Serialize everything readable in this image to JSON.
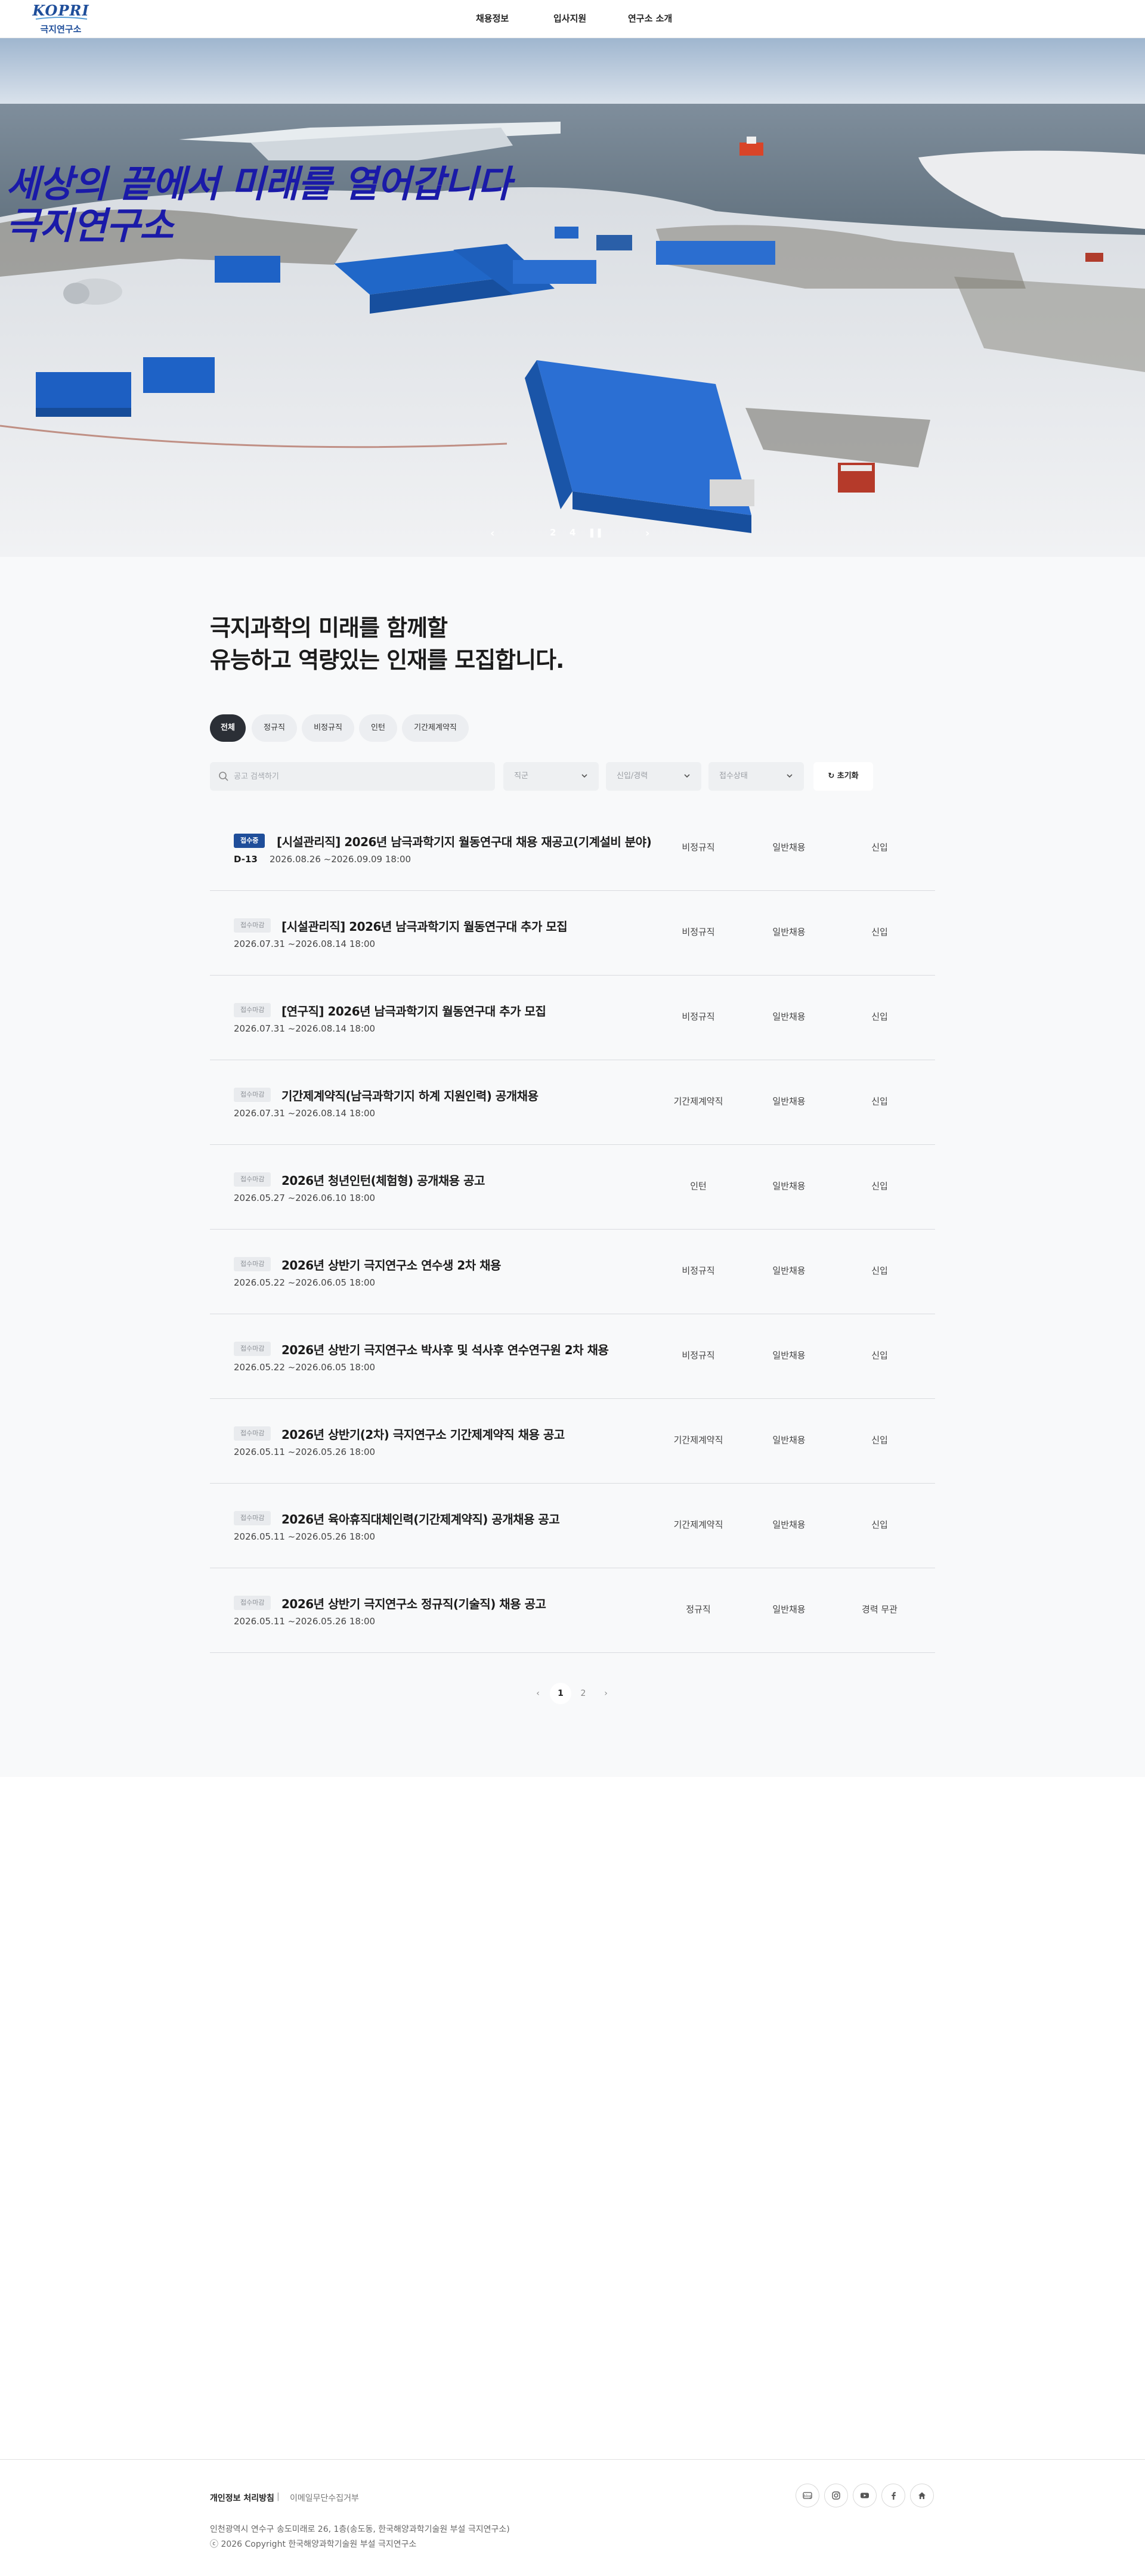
{
  "brand": {
    "logo_en": "KOPRI",
    "logo_ko": "극지연구소",
    "color": "#1f4e9a"
  },
  "nav": [
    {
      "label": "채용정보"
    },
    {
      "label": "입사지원"
    },
    {
      "label": "연구소 소개"
    }
  ],
  "hero": {
    "line1": "세상의 끝에서 미래를 열어갑니다",
    "line2": "극지연구소",
    "slide_current": "2",
    "slide_total": "4",
    "prev_icon": "chevron-left-icon",
    "pause_icon": "pause-icon",
    "next_icon": "chevron-right-icon"
  },
  "headline": {
    "line1": "극지과학의 미래를 함께할",
    "line2": "유능하고 역량있는 인재를 모집합니다."
  },
  "tabs": [
    {
      "label": "전체",
      "active": true
    },
    {
      "label": "정규직"
    },
    {
      "label": "비정규직"
    },
    {
      "label": "인턴"
    },
    {
      "label": "기간제계약직"
    }
  ],
  "filters": {
    "search_placeholder": "공고 검색하기",
    "search_value": "",
    "selects": [
      {
        "label": "직군"
      },
      {
        "label": "신입/경력"
      },
      {
        "label": "접수상태"
      }
    ],
    "reset_label": "초기화"
  },
  "postings": [
    {
      "status": "접수중",
      "open": true,
      "dday": "D-13",
      "title": "[시설관리직] 2026년 남극과학기지 월동연구대 채용 재공고(기계설비 분야)",
      "period": "2026.08.26 ~2026.09.09 18:00",
      "type": "비정규직",
      "hire": "일반채용",
      "career": "신입"
    },
    {
      "status": "접수마감",
      "title": "[시설관리직] 2026년 남극과학기지 월동연구대 추가 모집",
      "period": "2026.07.31 ~2026.08.14 18:00",
      "type": "비정규직",
      "hire": "일반채용",
      "career": "신입"
    },
    {
      "status": "접수마감",
      "title": "[연구직] 2026년 남극과학기지 월동연구대 추가 모집",
      "period": "2026.07.31 ~2026.08.14 18:00",
      "type": "비정규직",
      "hire": "일반채용",
      "career": "신입"
    },
    {
      "status": "접수마감",
      "title": "기간제계약직(남극과학기지 하계 지원인력) 공개채용",
      "period": "2026.07.31 ~2026.08.14 18:00",
      "type": "기간제계약직",
      "hire": "일반채용",
      "career": "신입"
    },
    {
      "status": "접수마감",
      "title": "2026년 청년인턴(체험형) 공개채용 공고",
      "period": "2026.05.27 ~2026.06.10 18:00",
      "type": "인턴",
      "hire": "일반채용",
      "career": "신입"
    },
    {
      "status": "접수마감",
      "title": "2026년 상반기 극지연구소 연수생 2차 채용",
      "period": "2026.05.22 ~2026.06.05 18:00",
      "type": "비정규직",
      "hire": "일반채용",
      "career": "신입"
    },
    {
      "status": "접수마감",
      "title": "2026년 상반기 극지연구소 박사후 및 석사후 연수연구원 2차 채용",
      "period": "2026.05.22 ~2026.06.05 18:00",
      "type": "비정규직",
      "hire": "일반채용",
      "career": "신입"
    },
    {
      "status": "접수마감",
      "title": "2026년 상반기(2차) 극지연구소 기간제계약직 채용 공고",
      "period": "2026.05.11 ~2026.05.26 18:00",
      "type": "기간제계약직",
      "hire": "일반채용",
      "career": "신입"
    },
    {
      "status": "접수마감",
      "title": "2026년 육아휴직대체인력(기간제계약직) 공개채용 공고",
      "period": "2026.05.11 ~2026.05.26 18:00",
      "type": "기간제계약직",
      "hire": "일반채용",
      "career": "신입"
    },
    {
      "status": "접수마감",
      "title": "2026년 상반기 극지연구소 정규직(기술직) 채용 공고",
      "period": "2026.05.11 ~2026.05.26 18:00",
      "type": "정규직",
      "hire": "일반채용",
      "career": "경력 무관"
    }
  ],
  "pagination": {
    "pages": [
      "1",
      "2"
    ],
    "current": "1",
    "prev": "‹",
    "next": "›"
  },
  "footer": {
    "privacy": "개인정보 처리방침",
    "email_refusal": "이메일무단수집거부",
    "separator": "|",
    "address": "인천광역시 연수구 송도미래로 26, 1층(송도동, 한국해양과학기술원 부설 극지연구소)",
    "copyright": "ⓒ 2026 Copyright 한국해양과학기술원 부설 극지연구소",
    "sns": [
      "blog-icon",
      "instagram-icon",
      "youtube-icon",
      "facebook-icon",
      "home-icon"
    ]
  }
}
